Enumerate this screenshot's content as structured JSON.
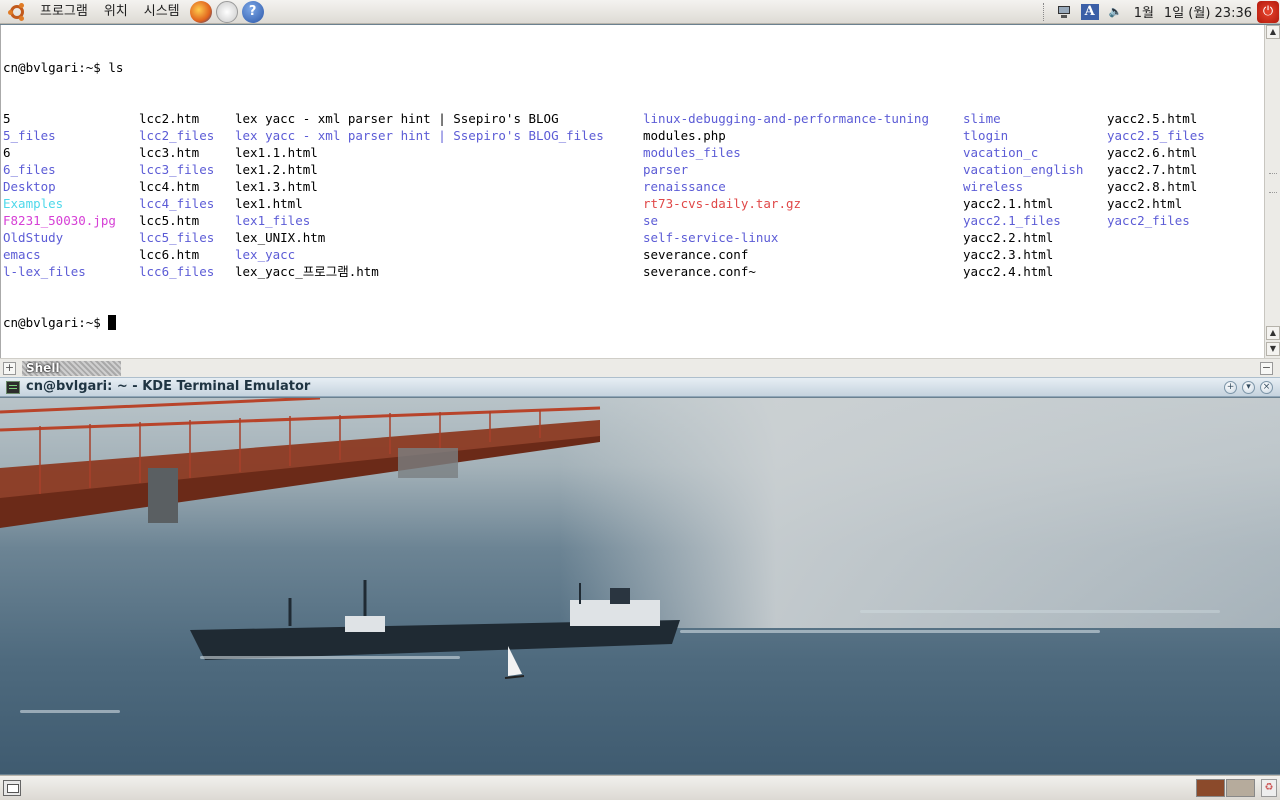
{
  "top_panel": {
    "menus": [
      "프로그램",
      "위치",
      "시스템"
    ],
    "launchers": {
      "firefox_icon": "firefox-icon",
      "mail_icon": "evolution-mail-icon",
      "help_icon": "help-icon",
      "help_glyph": "?"
    },
    "tray": {
      "input_method_label": "A",
      "volume_glyph": "🔈",
      "power_glyph": "⏻"
    },
    "clock_month": "1월",
    "clock_datetime": "1일 (월) 23:36"
  },
  "terminal": {
    "prompt_command": "cn@bvlgari:~$ ls",
    "prompt_after": "cn@bvlgari:~$ ",
    "listing": [
      [
        {
          "t": "5",
          "c": ""
        },
        {
          "t": "lcc2.htm",
          "c": ""
        },
        {
          "t": "lex yacc - xml parser hint | Ssepiro's BLOG",
          "c": ""
        },
        {
          "t": "linux-debugging-and-performance-tuning",
          "c": "dir"
        },
        {
          "t": "slime",
          "c": "dir"
        },
        {
          "t": "yacc2.5.html",
          "c": ""
        }
      ],
      [
        {
          "t": "5_files",
          "c": "dir"
        },
        {
          "t": "lcc2_files",
          "c": "dir"
        },
        {
          "t": "lex yacc - xml parser hint | Ssepiro's BLOG_files",
          "c": "dir"
        },
        {
          "t": "modules.php",
          "c": ""
        },
        {
          "t": "tlogin",
          "c": "dir"
        },
        {
          "t": "yacc2.5_files",
          "c": "dir"
        }
      ],
      [
        {
          "t": "6",
          "c": ""
        },
        {
          "t": "lcc3.htm",
          "c": ""
        },
        {
          "t": "lex1.1.html",
          "c": ""
        },
        {
          "t": "modules_files",
          "c": "dir"
        },
        {
          "t": "vacation_c",
          "c": "dir"
        },
        {
          "t": "yacc2.6.html",
          "c": ""
        }
      ],
      [
        {
          "t": "6_files",
          "c": "dir"
        },
        {
          "t": "lcc3_files",
          "c": "dir"
        },
        {
          "t": "lex1.2.html",
          "c": ""
        },
        {
          "t": "parser",
          "c": "dir"
        },
        {
          "t": "vacation_english",
          "c": "dir"
        },
        {
          "t": "yacc2.7.html",
          "c": ""
        }
      ],
      [
        {
          "t": "Desktop",
          "c": "dir"
        },
        {
          "t": "lcc4.htm",
          "c": ""
        },
        {
          "t": "lex1.3.html",
          "c": ""
        },
        {
          "t": "renaissance",
          "c": "dir"
        },
        {
          "t": "wireless",
          "c": "dir"
        },
        {
          "t": "yacc2.8.html",
          "c": ""
        }
      ],
      [
        {
          "t": "Examples",
          "c": "cyan"
        },
        {
          "t": "lcc4_files",
          "c": "dir"
        },
        {
          "t": "lex1.html",
          "c": ""
        },
        {
          "t": "rt73-cvs-daily.tar.gz",
          "c": "red"
        },
        {
          "t": "yacc2.1.html",
          "c": ""
        },
        {
          "t": "yacc2.html",
          "c": ""
        }
      ],
      [
        {
          "t": "F8231_50030.jpg",
          "c": "magenta"
        },
        {
          "t": "lcc5.htm",
          "c": ""
        },
        {
          "t": "lex1_files",
          "c": "dir"
        },
        {
          "t": "se",
          "c": "dir"
        },
        {
          "t": "yacc2.1_files",
          "c": "dir"
        },
        {
          "t": "yacc2_files",
          "c": "dir"
        }
      ],
      [
        {
          "t": "OldStudy",
          "c": "dir"
        },
        {
          "t": "lcc5_files",
          "c": "dir"
        },
        {
          "t": "lex_UNIX.htm",
          "c": ""
        },
        {
          "t": "self-service-linux",
          "c": "dir"
        },
        {
          "t": "yacc2.2.html",
          "c": ""
        },
        {
          "t": "",
          "c": ""
        }
      ],
      [
        {
          "t": "emacs",
          "c": "dir"
        },
        {
          "t": "lcc6.htm",
          "c": ""
        },
        {
          "t": "lex_yacc",
          "c": "dir"
        },
        {
          "t": "severance.conf",
          "c": ""
        },
        {
          "t": "yacc2.3.html",
          "c": ""
        },
        {
          "t": "",
          "c": ""
        }
      ],
      [
        {
          "t": "l-lex_files",
          "c": "dir"
        },
        {
          "t": "lcc6_files",
          "c": "dir"
        },
        {
          "t": "lex_yacc_프로그램.htm",
          "c": ""
        },
        {
          "t": "severance.conf~",
          "c": ""
        },
        {
          "t": "yacc2.4.html",
          "c": ""
        },
        {
          "t": "",
          "c": ""
        }
      ]
    ],
    "colors": {
      "dir": "#5c5cd6",
      "cyan": "#4ed8ea",
      "magenta": "#d640d6",
      "red": "#e04848"
    }
  },
  "tab_bar": {
    "tab_label": "Shell",
    "new_tab_glyph": "+",
    "close_glyph": "−"
  },
  "title_bar": {
    "title": "cn@bvlgari: ~ - KDE Terminal Emulator",
    "btn_plus": "+",
    "btn_down": "▾",
    "btn_close": "×"
  },
  "desktop": {
    "wallpaper": "golden-gate-bridge-ship-fog"
  },
  "bottom_panel": {
    "show_desktop_icon": "show-desktop-icon",
    "trash_icon": "trash-icon",
    "workspace_colors": [
      "#8b4a2b",
      "#b6ab9c"
    ]
  }
}
